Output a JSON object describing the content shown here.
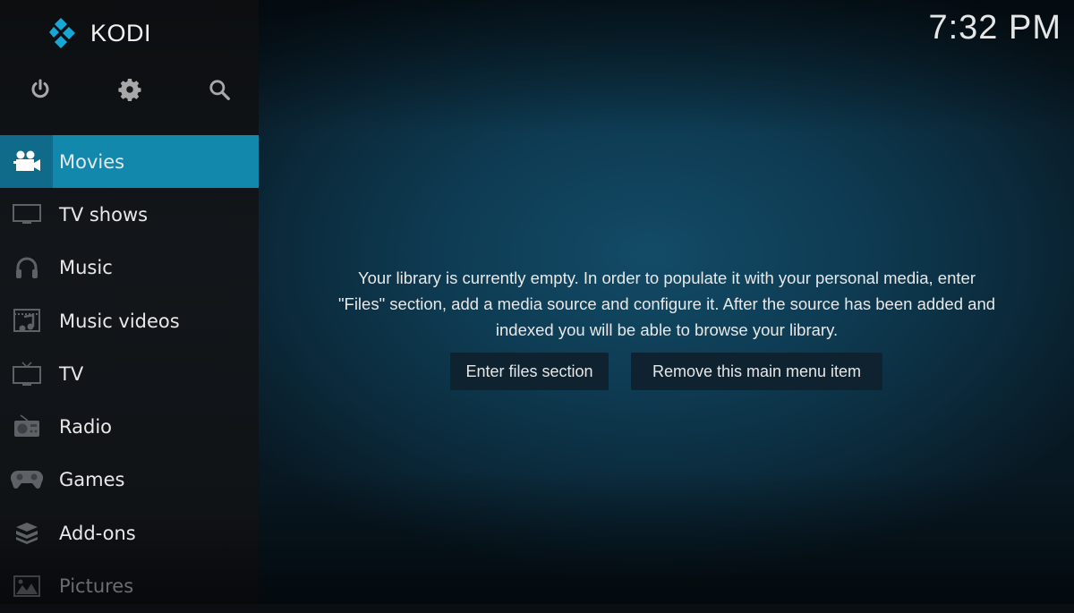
{
  "app": {
    "logo_text": "KODI",
    "accent": "#1288ad"
  },
  "clock": {
    "time": "7:32 PM"
  },
  "top_icons": [
    {
      "name": "power-icon",
      "label": "Power"
    },
    {
      "name": "settings-icon",
      "label": "Settings"
    },
    {
      "name": "search-icon",
      "label": "Search"
    }
  ],
  "sidebar": {
    "items": [
      {
        "label": "Movies",
        "icon": "movie-camera-icon",
        "active": true
      },
      {
        "label": "TV shows",
        "icon": "monitor-icon",
        "active": false
      },
      {
        "label": "Music",
        "icon": "headphones-icon",
        "active": false
      },
      {
        "label": "Music videos",
        "icon": "music-video-icon",
        "active": false
      },
      {
        "label": "TV",
        "icon": "tv-icon",
        "active": false
      },
      {
        "label": "Radio",
        "icon": "radio-icon",
        "active": false
      },
      {
        "label": "Games",
        "icon": "gamepad-icon",
        "active": false
      },
      {
        "label": "Add-ons",
        "icon": "addons-box-icon",
        "active": false
      },
      {
        "label": "Pictures",
        "icon": "picture-icon",
        "active": false
      }
    ]
  },
  "main": {
    "message_lines": [
      "Your library is currently empty. In order to populate it with your personal media, enter",
      "\"Files\" section, add a media source and configure it. After the source has been added and",
      "indexed you will be able to browse your library."
    ],
    "buttons": {
      "enter_files": "Enter files section",
      "remove_item": "Remove this main menu item"
    }
  }
}
